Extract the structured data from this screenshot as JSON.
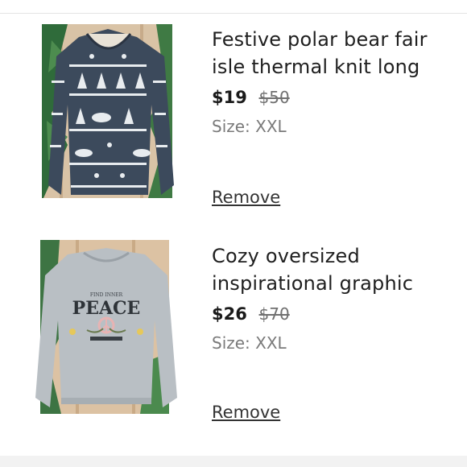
{
  "cart": {
    "items": [
      {
        "title": "Festive polar bear fair isle thermal knit long",
        "price": "$19",
        "original_price": "$50",
        "size": "Size: XXL",
        "remove_label": "Remove",
        "image": "grey fair isle polar bear sweater"
      },
      {
        "title": "Cozy oversized inspirational graphic",
        "price": "$26",
        "original_price": "$70",
        "size": "Size: XXL",
        "remove_label": "Remove",
        "image": "light grey PEACE graphic sweatshirt",
        "graphic_text": {
          "top": "FIND INNER",
          "main": "PEACE"
        }
      }
    ]
  },
  "colors": {
    "text": "#1f1f1f",
    "muted": "#707070",
    "sweater_navy": "#3c4a5c",
    "sweater_grey": "#b9bfc4"
  }
}
